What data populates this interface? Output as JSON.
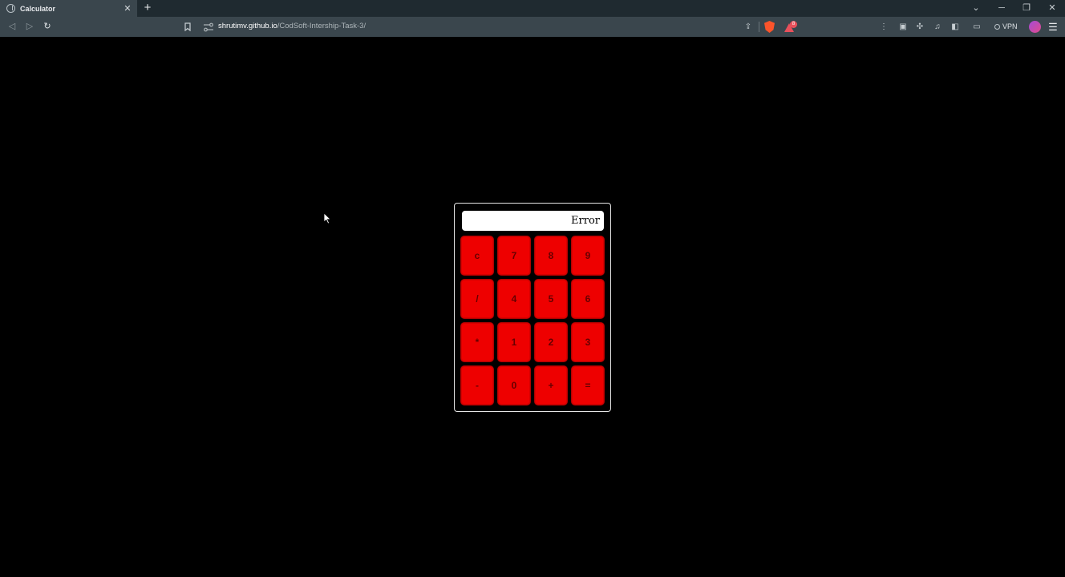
{
  "browser": {
    "tab_title": "Calculator",
    "tab_close": "✕",
    "new_tab": "+",
    "url_host": "shrutimv.github.io",
    "url_path": "/CodSoft-Intership-Task-3/",
    "vpn_label": "VPN",
    "rewards_badge": "8",
    "window_controls": {
      "list": "⌄",
      "minimize": "─",
      "restore": "❐",
      "close": "✕"
    },
    "nav": {
      "back": "◁",
      "forward": "▷",
      "reload": "↻"
    }
  },
  "calculator": {
    "display_value": "Error",
    "keys": [
      "c",
      "7",
      "8",
      "9",
      "/",
      "4",
      "5",
      "6",
      "*",
      "1",
      "2",
      "3",
      "-",
      "0",
      "+",
      "="
    ]
  },
  "colors": {
    "page_background": "#000000",
    "key_background": "#ee0000",
    "display_background": "#ffffff"
  }
}
